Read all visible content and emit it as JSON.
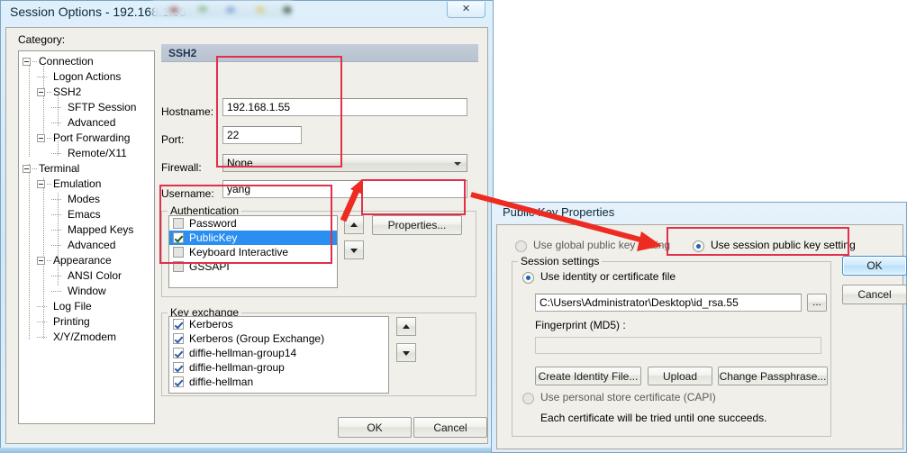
{
  "session_window": {
    "title": "Session Options - 192.168.1.55",
    "close_icon": "close-icon",
    "category_label": "Category:",
    "tree": [
      {
        "label": "Connection",
        "depth": 0,
        "expander": true
      },
      {
        "label": "Logon Actions",
        "depth": 1,
        "expander": false
      },
      {
        "label": "SSH2",
        "depth": 1,
        "expander": true
      },
      {
        "label": "SFTP Session",
        "depth": 2,
        "expander": false
      },
      {
        "label": "Advanced",
        "depth": 2,
        "expander": false
      },
      {
        "label": "Port Forwarding",
        "depth": 1,
        "expander": true
      },
      {
        "label": "Remote/X11",
        "depth": 2,
        "expander": false
      },
      {
        "label": "Terminal",
        "depth": 0,
        "expander": true
      },
      {
        "label": "Emulation",
        "depth": 1,
        "expander": true
      },
      {
        "label": "Modes",
        "depth": 2,
        "expander": false
      },
      {
        "label": "Emacs",
        "depth": 2,
        "expander": false
      },
      {
        "label": "Mapped Keys",
        "depth": 2,
        "expander": false
      },
      {
        "label": "Advanced",
        "depth": 2,
        "expander": false
      },
      {
        "label": "Appearance",
        "depth": 1,
        "expander": true
      },
      {
        "label": "ANSI Color",
        "depth": 2,
        "expander": false
      },
      {
        "label": "Window",
        "depth": 2,
        "expander": false
      },
      {
        "label": "Log File",
        "depth": 1,
        "expander": false
      },
      {
        "label": "Printing",
        "depth": 1,
        "expander": false
      },
      {
        "label": "X/Y/Zmodem",
        "depth": 1,
        "expander": false
      }
    ],
    "pane": {
      "header": "SSH2",
      "hostname_label": "Hostname:",
      "hostname_value": "192.168.1.55",
      "port_label": "Port:",
      "port_value": "22",
      "firewall_label": "Firewall:",
      "firewall_value": "None",
      "username_label": "Username:",
      "username_value": "yang"
    },
    "authentication": {
      "title": "Authentication",
      "items": [
        {
          "label": "Password",
          "checked": false,
          "selected": false
        },
        {
          "label": "PublicKey",
          "checked": true,
          "selected": true
        },
        {
          "label": "Keyboard Interactive",
          "checked": false,
          "selected": false
        },
        {
          "label": "GSSAPI",
          "checked": false,
          "selected": false
        }
      ],
      "move_up_icon": "arrow-up-icon",
      "move_down_icon": "arrow-down-icon",
      "properties_button": "Properties..."
    },
    "key_exchange": {
      "title": "Key exchange",
      "items": [
        {
          "label": "Kerberos",
          "checked": true
        },
        {
          "label": "Kerberos (Group Exchange)",
          "checked": true
        },
        {
          "label": "diffie-hellman-group14",
          "checked": true
        },
        {
          "label": "diffie-hellman-group",
          "checked": true
        },
        {
          "label": "diffie-hellman",
          "checked": true
        }
      ],
      "move_up_icon": "arrow-up-icon",
      "move_down_icon": "arrow-down-icon"
    },
    "ok_button": "OK",
    "cancel_button": "Cancel"
  },
  "pubkey_window": {
    "title": "Public Key Properties",
    "global_radio_label": "Use global public key setting",
    "global_radio_selected": false,
    "session_radio_label": "Use session public key setting",
    "session_radio_selected": true,
    "session_settings_title": "Session settings",
    "identity_radio_label": "Use identity or certificate file",
    "identity_radio_selected": true,
    "identity_path": "C:\\Users\\Administrator\\Desktop\\id_rsa.55",
    "browse_button": "...",
    "fingerprint_label": "Fingerprint (MD5) :",
    "fingerprint_value": "",
    "create_identity_button": "Create Identity File...",
    "upload_button": "Upload",
    "change_passphrase_button": "Change Passphrase...",
    "capi_radio_label": "Use personal store certificate (CAPI)",
    "capi_radio_selected": false,
    "capi_note": "Each certificate will be tried until one succeeds.",
    "ok_button": "OK",
    "cancel_button": "Cancel"
  },
  "annotations": {
    "highlight_color": "#e0304a",
    "arrow_color": "#ee2b21",
    "boxes": [
      "connection-fields-highlight",
      "authentication-list-highlight",
      "properties-button-highlight",
      "session-key-setting-highlight"
    ],
    "arrows": [
      "arrow-to-properties-button",
      "arrow-to-session-key-setting"
    ]
  }
}
